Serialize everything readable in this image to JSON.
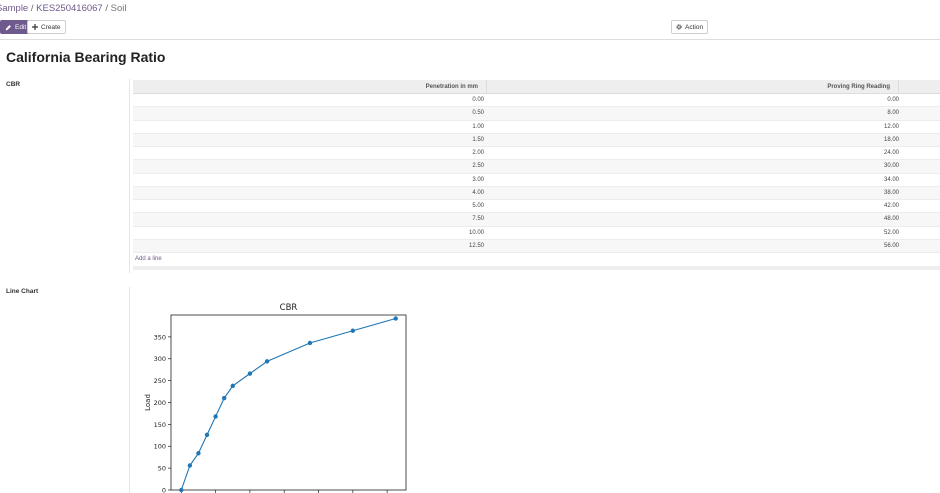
{
  "breadcrumb": {
    "items": [
      "Sample",
      "KES250416067"
    ],
    "separator": "/",
    "current": "Soil"
  },
  "toolbar": {
    "edit_label": "Edit",
    "create_label": "Create",
    "action_label": "Action"
  },
  "page": {
    "title": "California Bearing Ratio"
  },
  "cbr_field": {
    "label": "CBR",
    "columns": [
      "Penetration in mm",
      "Proving Ring Reading"
    ],
    "rows": [
      [
        "0.00",
        "0.00"
      ],
      [
        "0.50",
        "8.00"
      ],
      [
        "1.00",
        "12.00"
      ],
      [
        "1.50",
        "18.00"
      ],
      [
        "2.00",
        "24.00"
      ],
      [
        "2.50",
        "30.00"
      ],
      [
        "3.00",
        "34.00"
      ],
      [
        "4.00",
        "38.00"
      ],
      [
        "5.00",
        "42.00"
      ],
      [
        "7.50",
        "48.00"
      ],
      [
        "10.00",
        "52.00"
      ],
      [
        "12.50",
        "56.00"
      ]
    ],
    "add_line_label": "Add a line"
  },
  "line_chart_field": {
    "label": "Line Chart"
  },
  "colors": {
    "accent": "#6f5a8d",
    "series": "#1f77b4"
  },
  "chart_data": {
    "type": "line",
    "title": "CBR",
    "xlabel": "",
    "ylabel": "Load",
    "x": [
      0.0,
      0.5,
      1.0,
      1.5,
      2.0,
      2.5,
      3.0,
      4.0,
      5.0,
      7.5,
      10.0,
      12.5
    ],
    "series": [
      {
        "values": [
          0,
          56,
          84,
          126,
          168,
          210,
          238,
          266,
          294,
          336,
          364,
          392
        ]
      }
    ],
    "xlim": [
      -0.6,
      13.1
    ],
    "ylim": [
      0,
      400
    ],
    "yticks": [
      "0",
      "50",
      "100",
      "150",
      "200",
      "250",
      "300",
      "350"
    ],
    "grid": false
  }
}
